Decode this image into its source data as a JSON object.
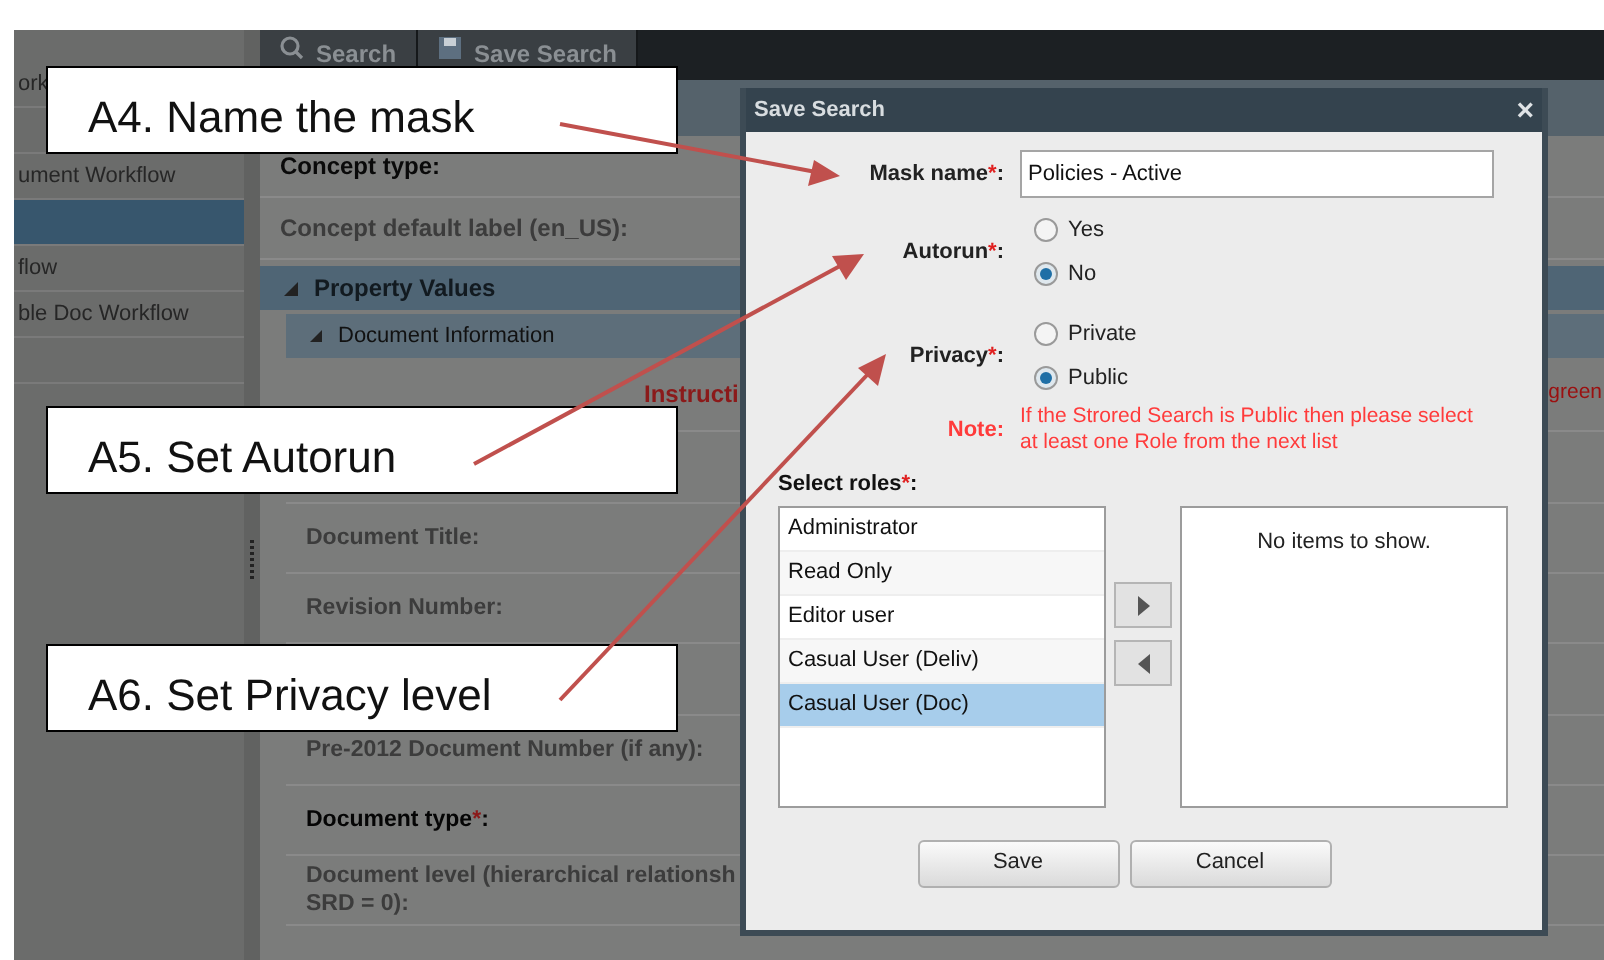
{
  "sidebar": {
    "items": [
      {
        "label": "ork",
        "selected": false
      },
      {
        "selected": false
      },
      {
        "label": "ument Workflow",
        "selected": false
      },
      {
        "selected": true
      },
      {
        "label": "flow",
        "selected": false
      },
      {
        "label": "ble Doc Workflow",
        "selected": false
      },
      {
        "selected": false
      }
    ]
  },
  "toolbar": {
    "tabs": [
      {
        "kind": "search",
        "label": "Search"
      },
      {
        "kind": "save",
        "label": "Save Search"
      }
    ]
  },
  "form": {
    "fields": [
      {
        "label": "Concept type:",
        "disabled": false
      },
      {
        "label": "Concept default label (en_US):",
        "disabled": true
      }
    ],
    "sections": [
      {
        "title": "Property Values",
        "children": [
          {
            "title": "Document Information",
            "rows": [
              {
                "kind": "instruction",
                "text": "Instructi",
                "overflow_text": "green"
              },
              {
                "kind": "blank"
              },
              {
                "kind": "field",
                "label": "Document Title:",
                "disabled": true
              },
              {
                "kind": "field",
                "label": "Revision Number:",
                "disabled": true
              },
              {
                "kind": "blank"
              },
              {
                "kind": "field",
                "label": "Pre-2012 Document Number (if any):",
                "disabled": true
              },
              {
                "kind": "field",
                "label": "Document type",
                "asterisk": "*",
                "suffix": ":",
                "disabled": false
              },
              {
                "kind": "field",
                "label": "Document level (hierarchical relationsh\nSRD = 0):",
                "disabled": true
              }
            ]
          }
        ]
      }
    ]
  },
  "dialog": {
    "title": "Save Search",
    "close": "×",
    "mask_name": {
      "label": "Mask name",
      "asterisk": "*",
      "suffix": ":",
      "value": "Policies - Active"
    },
    "autorun": {
      "label": "Autorun",
      "asterisk": "*",
      "suffix": ":",
      "options": [
        {
          "label": "Yes",
          "selected": false
        },
        {
          "label": "No",
          "selected": true
        }
      ]
    },
    "privacy": {
      "label": "Privacy",
      "asterisk": "*",
      "suffix": ":",
      "options": [
        {
          "label": "Private",
          "selected": false
        },
        {
          "label": "Public",
          "selected": true
        }
      ]
    },
    "note": {
      "label": "Note:",
      "text": "If the Strored Search is Public then please select at least one Role from the next list"
    },
    "roles": {
      "label": "Select roles",
      "asterisk": "*",
      "suffix": ":",
      "available": [
        {
          "label": "Administrator",
          "selected": false
        },
        {
          "label": "Read Only",
          "selected": false
        },
        {
          "label": "Editor user",
          "selected": false
        },
        {
          "label": "Casual User (Deliv)",
          "selected": false
        },
        {
          "label": "Casual User (Doc)",
          "selected": true
        }
      ],
      "chosen_empty_text": "No items to show."
    },
    "buttons": [
      {
        "label": "Save"
      },
      {
        "label": "Cancel"
      }
    ]
  },
  "callouts": [
    {
      "text": "A4. Name the mask"
    },
    {
      "text": "A5. Set Autorun"
    },
    {
      "text": "A6. Set Privacy level"
    }
  ]
}
